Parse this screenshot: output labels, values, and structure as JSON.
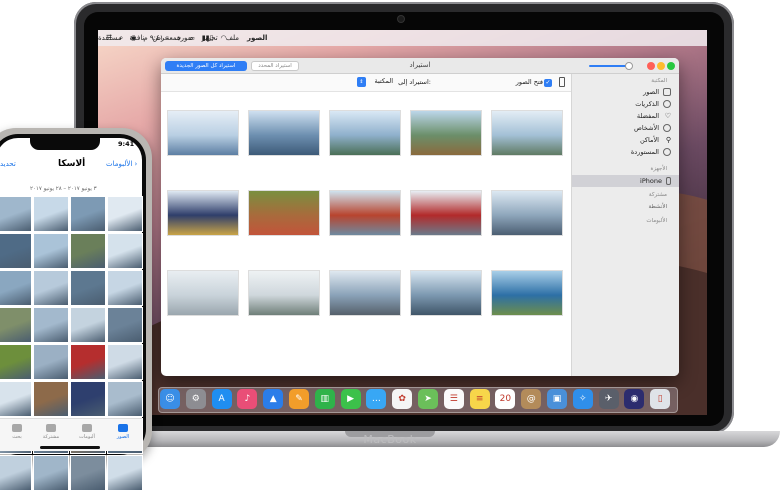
{
  "mac": {
    "brand": "MacBook",
    "menubar": {
      "items": [
        "الصور",
        "ملف",
        "تحرير",
        "صورة",
        "عرض",
        "نافذة",
        "مساعدة"
      ],
      "clock": "جمعة ٩:٤١ م"
    },
    "window": {
      "title": "استيراد",
      "import_all_button": "استيراد كل الصور الجديدة",
      "import_selected_button": "استيراد المحدد",
      "delete_items_label": "فتح الصور",
      "import_to_label": "استيراد إلى:",
      "library_value": "المكتبة"
    },
    "sidebar": {
      "library_header": "المكتبة",
      "items": [
        "الصور",
        "الذكريات",
        "المفضلة",
        "الأشخاص",
        "الأماكن",
        "المستوردة"
      ],
      "devices_header": "الأجهزة",
      "device": "iPhone",
      "shared_header": "مشتركة",
      "activity": "الأنشطة",
      "albums_header": "الألبومات"
    },
    "photos": [
      [
        "#e6eef6",
        "#b9cfe3",
        "#5d7fa3"
      ],
      [
        "#cfe0f0",
        "#6d8fb0",
        "#3d5a78"
      ],
      [
        "#d9e8f5",
        "#8fb0cc",
        "#4a6f56"
      ],
      [
        "#bcd6ea",
        "#6b8f6a",
        "#8a6a3d"
      ],
      [
        "#e3edf5",
        "#a3c0d6",
        "#5f7a63"
      ],
      [
        "#dfe9f3",
        "#2f3e6b",
        "#c9a447"
      ],
      [
        "#7a8f3f",
        "#a86b3c",
        "#c2543a"
      ],
      [
        "#cfe2ee",
        "#b8442e",
        "#6e8aa0"
      ],
      [
        "#e7eef4",
        "#b22a2a",
        "#6b7a8a"
      ],
      [
        "#dce8f2",
        "#8ea6bb",
        "#4b5e72"
      ],
      [
        "#e9eef2",
        "#c9d3da",
        "#9aa6ae"
      ],
      [
        "#eef2f4",
        "#cfd7dc",
        "#6f7f79"
      ],
      [
        "#dfe8f0",
        "#8aa2b8",
        "#55606b"
      ],
      [
        "#d7e5f0",
        "#7c98b0",
        "#3f5568"
      ],
      [
        "#a9cfe8",
        "#2d6fa6",
        "#6d8e4c"
      ]
    ],
    "dock": [
      {
        "icon": "finder-icon",
        "color": "#3a8ee6",
        "glyph": "☺"
      },
      {
        "icon": "system-preferences-icon",
        "color": "#8d8d92",
        "glyph": "⚙"
      },
      {
        "icon": "app-store-icon",
        "color": "#1f8ef1",
        "glyph": "A"
      },
      {
        "icon": "itunes-icon",
        "color": "#e94e77",
        "glyph": "♪"
      },
      {
        "icon": "keynote-icon",
        "color": "#2b7de9",
        "glyph": "▲"
      },
      {
        "icon": "pages-icon",
        "color": "#f29d2a",
        "glyph": "✎"
      },
      {
        "icon": "numbers-icon",
        "color": "#2fb34a",
        "glyph": "▥"
      },
      {
        "icon": "facetime-icon",
        "color": "#3cc14a",
        "glyph": "▶"
      },
      {
        "icon": "messages-icon",
        "color": "#38a7f5",
        "glyph": "…"
      },
      {
        "icon": "photos-icon",
        "color": "#f5f5f5",
        "glyph": "✿"
      },
      {
        "icon": "maps-icon",
        "color": "#6bbf5a",
        "glyph": "➤"
      },
      {
        "icon": "reminders-icon",
        "color": "#fafafa",
        "glyph": "☰"
      },
      {
        "icon": "notes-icon",
        "color": "#f7d64a",
        "glyph": "≡"
      },
      {
        "icon": "calendar-icon",
        "color": "#ffffff",
        "glyph": "20"
      },
      {
        "icon": "contacts-icon",
        "color": "#b38b5a",
        "glyph": "@"
      },
      {
        "icon": "preview-icon",
        "color": "#4a90d9",
        "glyph": "▣"
      },
      {
        "icon": "safari-icon",
        "color": "#2f8fea",
        "glyph": "✧"
      },
      {
        "icon": "launchpad-icon",
        "color": "#5a5f6a",
        "glyph": "✈"
      },
      {
        "icon": "siri-icon",
        "color": "#2c2c6e",
        "glyph": "◉"
      },
      {
        "icon": "trash-icon",
        "color": "#dfe3e8",
        "glyph": "▯"
      }
    ]
  },
  "iphone": {
    "time": "9:41",
    "back_label": "الألبومات",
    "title": "ألاسكا",
    "select_label": "تحديد",
    "subtitle": "٣ يونيو ٢٠١٧ – ٢٨ يونيو ٢٠١٧",
    "tiles": [
      "#9fb7cc",
      "#c7d9e8",
      "#7d9ab4",
      "#e0e9f1",
      "#4f6b86",
      "#aac3d8",
      "#6a7f5a",
      "#d5e2ec",
      "#8aa7c0",
      "#b7cadb",
      "#5d7890",
      "#c6d6e4",
      "#7f8f6a",
      "#a3b9cd",
      "#c4d3df",
      "#6b8298",
      "#6d8f3c",
      "#9bb0c4",
      "#b52e2e",
      "#cfdbe6",
      "#d8e3ec",
      "#8d6a4a",
      "#2e3f6e",
      "#a9bccd",
      "#b2c5d6",
      "#7f98ae",
      "#9c7e5c",
      "#5f7a91",
      "#c0d0de",
      "#a0b6c9",
      "#7c8d9d",
      "#d0dde8"
    ],
    "tabs": [
      "بحث",
      "مشتركة",
      "ألبومات",
      "الصور"
    ],
    "active_tab": 3
  }
}
